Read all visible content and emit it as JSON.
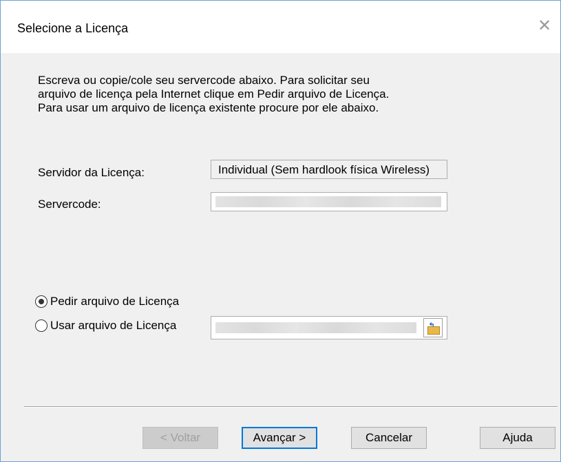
{
  "dialog": {
    "title": "Selecione a Licença",
    "close_glyph": "✕"
  },
  "instructions": [
    "Escreva ou copie/cole seu servercode abaixo. Para solicitar seu",
    "arquivo de licença pela Internet clique em Pedir arquivo de Licença.",
    "Para usar um arquivo de licença existente procure por ele abaixo."
  ],
  "fields": {
    "server_label": "Servidor da Licença:",
    "server_value": "Individual (Sem hardlook física Wireless)",
    "servercode_label": "Servercode:"
  },
  "options": {
    "request_label": "Pedir arquivo de Licença",
    "use_label": "Usar arquivo de Licença",
    "selected": "request"
  },
  "buttons": {
    "back": "< Voltar",
    "next": "Avançar >",
    "cancel": "Cancelar",
    "help": "Ajuda"
  },
  "icons": {
    "close": "close-icon",
    "browse": "folder-open-icon"
  }
}
